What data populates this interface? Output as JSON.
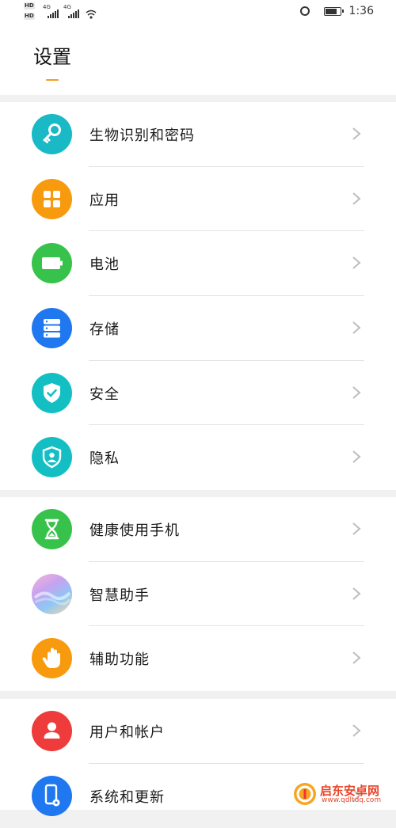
{
  "status_bar": {
    "net1": "4G",
    "net2": "4G",
    "hd": "HD",
    "time": "1:36"
  },
  "header": {
    "title": "设置"
  },
  "groups": [
    [
      {
        "label": "生物识别和密码",
        "icon": "key-icon",
        "color": "#19b9c6"
      },
      {
        "label": "应用",
        "icon": "apps-grid-icon",
        "color": "#f89a0e"
      },
      {
        "label": "电池",
        "icon": "battery-icon",
        "color": "#37c24c"
      },
      {
        "label": "存储",
        "icon": "storage-icon",
        "color": "#1f78f0"
      },
      {
        "label": "安全",
        "icon": "shield-check-icon",
        "color": "#14bfc4"
      },
      {
        "label": "隐私",
        "icon": "privacy-shield-icon",
        "color": "#14bfc4"
      }
    ],
    [
      {
        "label": "健康使用手机",
        "icon": "hourglass-icon",
        "color": "#37c24c"
      },
      {
        "label": "智慧助手",
        "icon": "assistant-icon",
        "color": "#c4a6ee"
      },
      {
        "label": "辅助功能",
        "icon": "hand-icon",
        "color": "#f89a0e"
      }
    ],
    [
      {
        "label": "用户和帐户",
        "icon": "user-icon",
        "color": "#ee3b3b"
      },
      {
        "label": "系统和更新",
        "icon": "system-update-icon",
        "color": "#1f78f0"
      }
    ]
  ],
  "watermark": {
    "text": "启东安卓网",
    "url": "www.qdltdq.com"
  }
}
